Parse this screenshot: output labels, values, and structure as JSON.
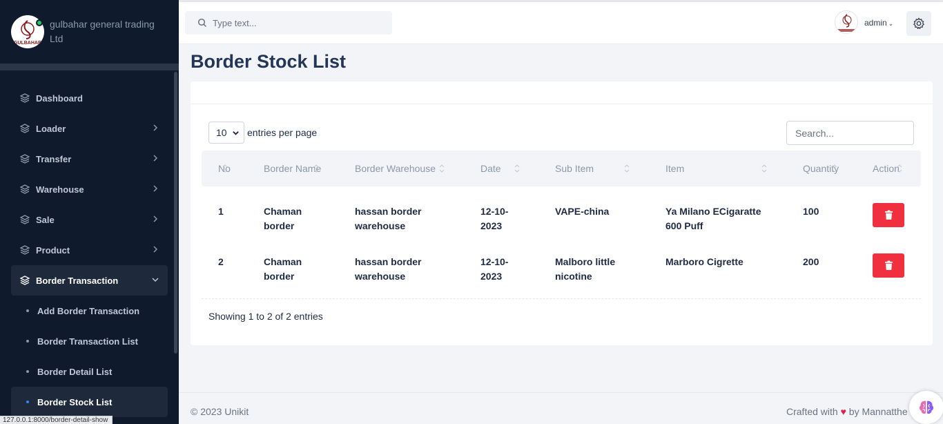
{
  "brand": {
    "name": "gulbahar general trading Ltd",
    "logo_text": "GULBAHAR"
  },
  "sidebar": {
    "items": [
      {
        "label": "Dashboard",
        "icon": "layers-icon",
        "has_chevron": false
      },
      {
        "label": "Loader",
        "icon": "layers-icon",
        "has_chevron": true
      },
      {
        "label": "Transfer",
        "icon": "layers-icon",
        "has_chevron": true
      },
      {
        "label": "Warehouse",
        "icon": "layers-icon",
        "has_chevron": true
      },
      {
        "label": "Sale",
        "icon": "layers-icon",
        "has_chevron": true
      },
      {
        "label": "Product",
        "icon": "layers-icon",
        "has_chevron": true
      },
      {
        "label": "Border Transaction",
        "icon": "layers-icon",
        "has_chevron": true,
        "expanded": true
      }
    ],
    "subitems": [
      {
        "label": "Add Border Transaction"
      },
      {
        "label": "Border Transaction List"
      },
      {
        "label": "Border Detail List"
      },
      {
        "label": "Border Stock List",
        "active": true
      }
    ]
  },
  "topbar": {
    "search_placeholder": "Type text...",
    "user": "admin",
    "caret": "⌄"
  },
  "page": {
    "title": "Border Stock List",
    "page_size": "10",
    "entries_label": "entries per page",
    "search_placeholder": "Search...",
    "showing": "Showing 1 to 2 of 2 entries"
  },
  "table": {
    "headers": [
      "No",
      "Border Name",
      "Border Warehouse",
      "Date",
      "Sub Item",
      "Item",
      "Quantity",
      "Action"
    ],
    "rows": [
      {
        "no": "1",
        "border_name": [
          "Chaman",
          "border"
        ],
        "warehouse": [
          "hassan border",
          "warehouse"
        ],
        "date": [
          "12-10-",
          "2023"
        ],
        "sub_item": [
          "VAPE-china"
        ],
        "item": [
          "Ya Milano ECigaratte",
          "600 Puff"
        ],
        "quantity": "100"
      },
      {
        "no": "2",
        "border_name": [
          "Chaman",
          "border"
        ],
        "warehouse": [
          "hassan border",
          "warehouse"
        ],
        "date": [
          "12-10-",
          "2023"
        ],
        "sub_item": [
          "Malboro little",
          "nicotine"
        ],
        "item": [
          "Marboro Cigrette"
        ],
        "quantity": "200"
      }
    ]
  },
  "footer": {
    "copyright": "© 2023 Unikit",
    "crafted_prefix": "Crafted with",
    "heart": "♥",
    "crafted_suffix": "by Mannatthe"
  },
  "status_url": "127.0.0.1:8000/border-detail-show",
  "colors": {
    "sidebar_bg": "#0f1b2d",
    "accent_red": "#f0303f",
    "title": "#243657",
    "active_dot": "#3b82f6"
  }
}
